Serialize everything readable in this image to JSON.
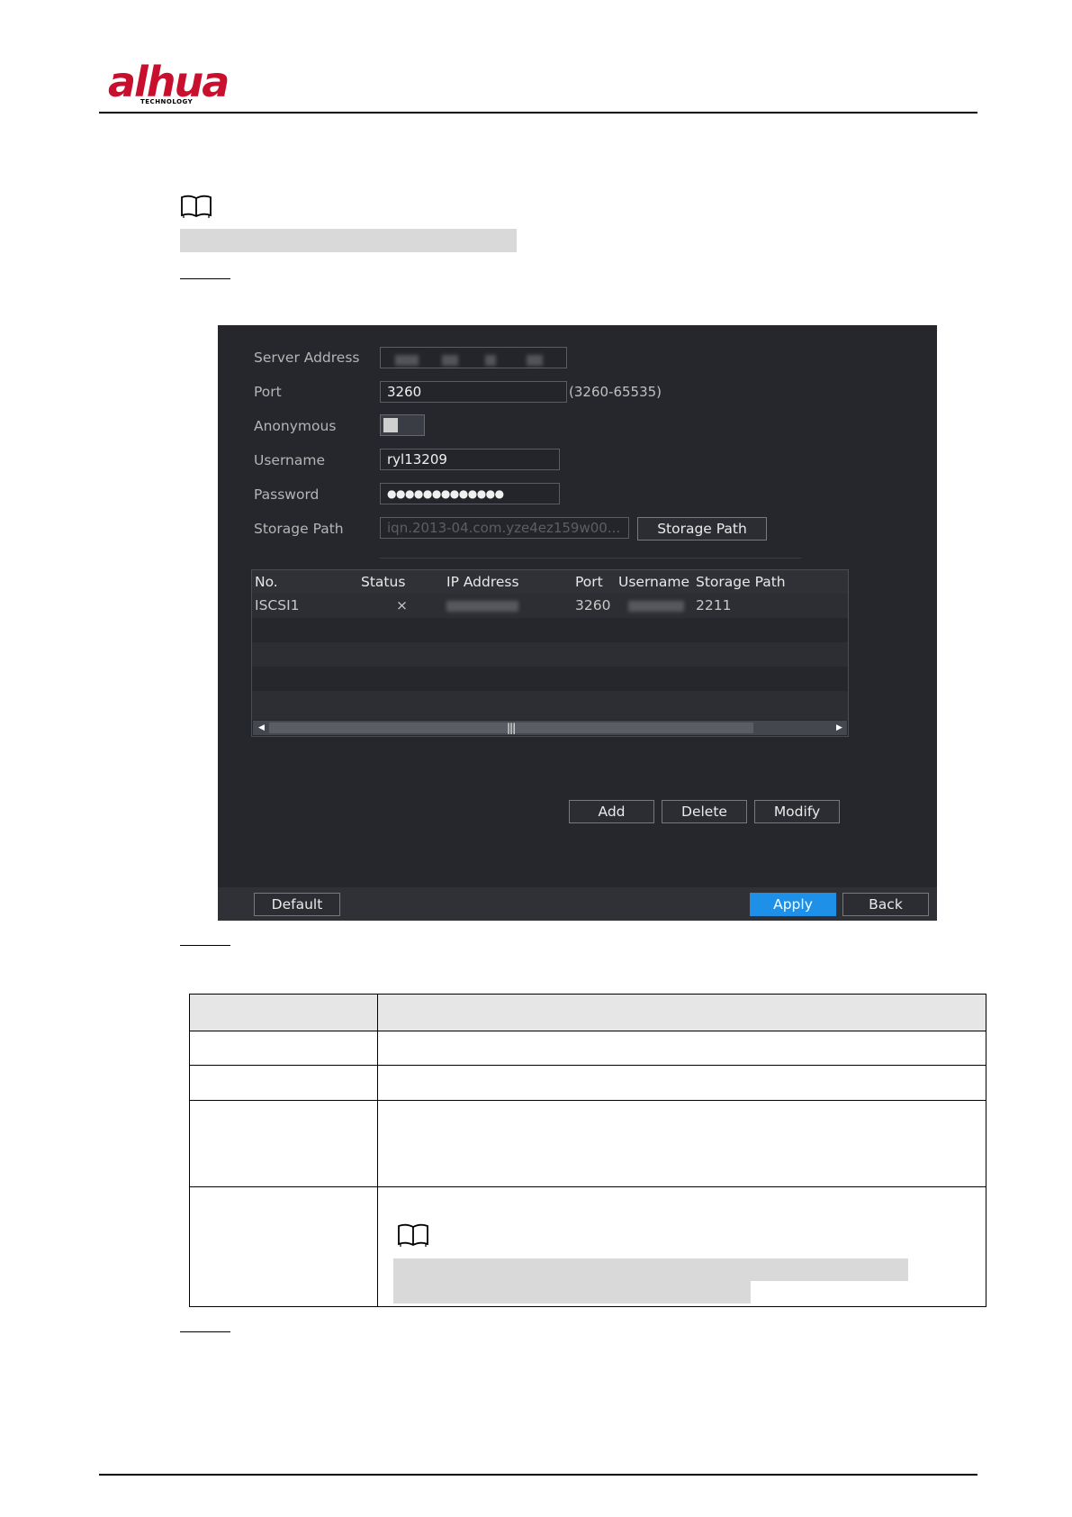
{
  "header": {
    "logo_text": "alhua",
    "logo_subtext": "TECHNOLOGY"
  },
  "icons": {
    "note": "book-icon"
  },
  "screen": {
    "form": {
      "server_address_label": "Server Address",
      "port_label": "Port",
      "port_value": "3260",
      "port_hint": "(3260-65535)",
      "anonymous_label": "Anonymous",
      "anonymous_enabled": false,
      "username_label": "Username",
      "username_value": "ryl13209",
      "password_label": "Password",
      "password_value": "●●●●●●●●●●●●●",
      "storage_path_label": "Storage Path",
      "storage_path_value": "iqn.2013-04.com.yze4ez159w00...",
      "storage_path_button": "Storage Path"
    },
    "table": {
      "columns": [
        "No.",
        "Status",
        "IP Address",
        "Port",
        "Username",
        "Storage Path"
      ],
      "rows": [
        {
          "no": "ISCSI1",
          "status": "×",
          "port": "3260",
          "storage_path": "2211"
        }
      ]
    },
    "actions": {
      "add": "Add",
      "delete": "Delete",
      "modify": "Modify"
    },
    "footer": {
      "default": "Default",
      "apply": "Apply",
      "back": "Back"
    },
    "colors": {
      "background": "#25272c",
      "accent": "#1e90e8",
      "status_error": "#e23b3b"
    }
  }
}
